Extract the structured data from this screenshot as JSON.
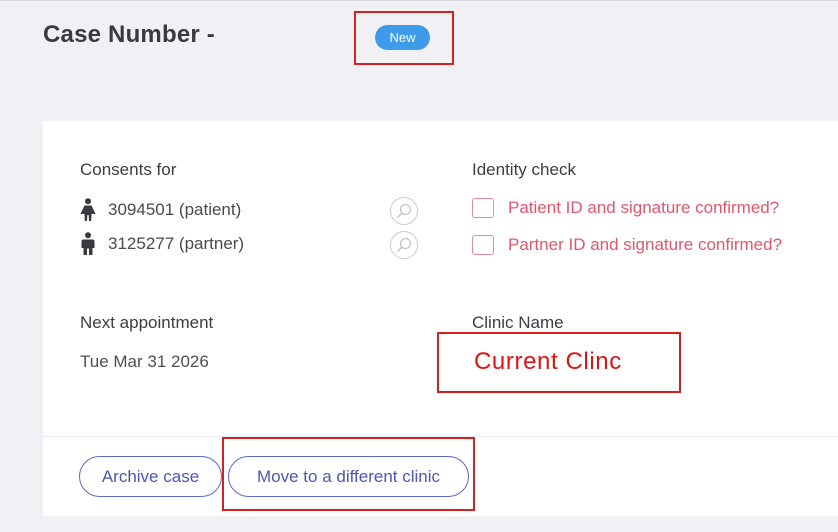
{
  "header": {
    "case_title": "Case Number -",
    "status_badge": "New"
  },
  "consents": {
    "label": "Consents for",
    "patient": "3094501 (patient)",
    "partner": "3125277 (partner)"
  },
  "identity": {
    "label": "Identity check",
    "patient_check": "Patient ID and signature confirmed?",
    "partner_check": "Partner ID and signature confirmed?"
  },
  "appointment": {
    "label": "Next appointment",
    "date": "Tue Mar 31 2026"
  },
  "clinic": {
    "label": "Clinic Name",
    "value": "Current Clinc"
  },
  "actions": {
    "archive_label": "Archive case",
    "move_label": "Move to a different clinic"
  },
  "colors": {
    "badge": "#3d9be9",
    "annotation": "#d61f1f",
    "identity_text": "#e2566c",
    "button_outline": "#5f6ac4"
  }
}
